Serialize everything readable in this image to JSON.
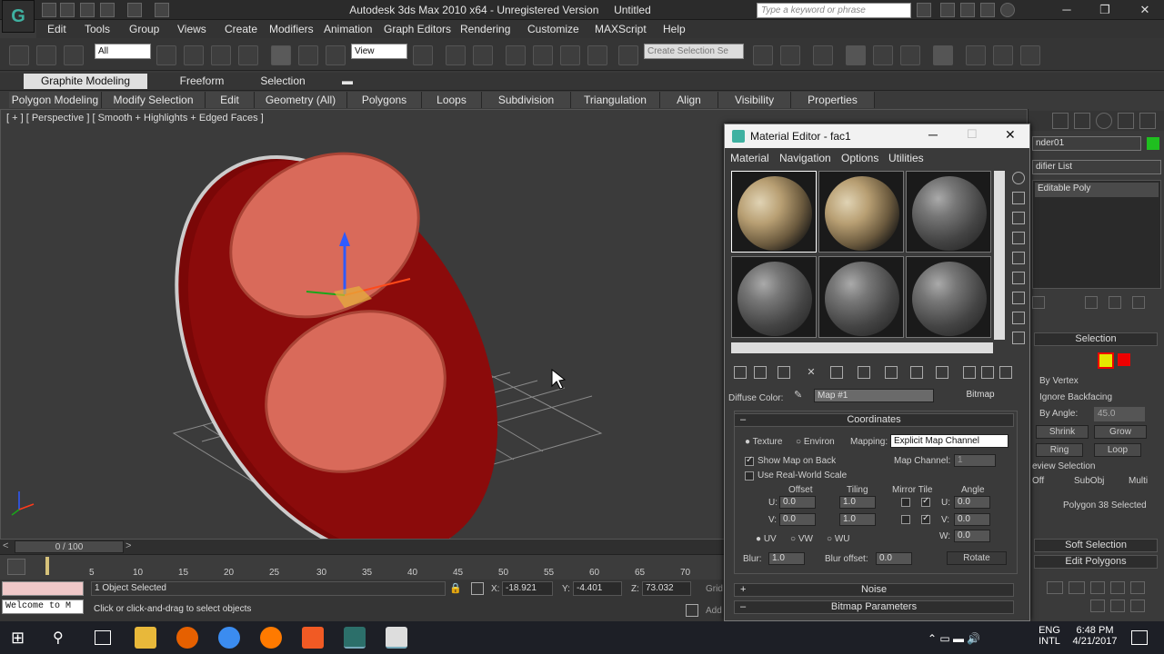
{
  "titlebar": {
    "app_title": "Autodesk 3ds Max  2010 x64  -  Unregistered Version",
    "doc_name": "Untitled",
    "search_placeholder": "Type a keyword or phrase",
    "logo_glyph": "G"
  },
  "menu": [
    "Edit",
    "Tools",
    "Group",
    "Views",
    "Create",
    "Modifiers",
    "Animation",
    "Graph Editors",
    "Rendering",
    "Customize",
    "MAXScript",
    "Help"
  ],
  "toolbar": {
    "filter_value": "All",
    "ref_coord_value": "View",
    "selection_set_placeholder": "Create Selection Se"
  },
  "ribbon": {
    "tabs": [
      "Graphite Modeling Tools",
      "Freeform",
      "Selection"
    ],
    "panels": [
      "Polygon Modeling",
      "Modify Selection",
      "Edit",
      "Geometry (All)",
      "Polygons",
      "Loops",
      "Subdivision",
      "Triangulation",
      "Align",
      "Visibility",
      "Properties"
    ]
  },
  "viewport": {
    "label": "[ + ] [ Perspective ] [ Smooth + Highlights + Edged Faces ]"
  },
  "timeline": {
    "frame_display": "0 / 100",
    "ticks": [
      "5",
      "10",
      "15",
      "20",
      "25",
      "30",
      "35",
      "40",
      "45",
      "50",
      "55",
      "60",
      "65",
      "70"
    ]
  },
  "status": {
    "maxscript_prompt": "Welcome to M",
    "selected": "1 Object Selected",
    "hint": "Click or click-and-drag to select objects",
    "x_label": "X:",
    "x": "-18.921",
    "y_label": "Y:",
    "y": "-4.401",
    "z_label": "Z:",
    "z": "73.032",
    "grid_label": "Grid",
    "add_label": "Add"
  },
  "taskbar": {
    "lang": "ENG",
    "layout": "INTL",
    "time": "6:48 PM",
    "date": "4/21/2017"
  },
  "command_panel": {
    "object_name": "nder01",
    "modifier_list": "difier List",
    "stack_item": "Editable Poly",
    "selection_title": "Selection",
    "by_vertex": "By Vertex",
    "ignore_backfacing": "Ignore Backfacing",
    "by_angle": "By Angle:",
    "by_angle_value": "45.0",
    "shrink": "Shrink",
    "grow": "Grow",
    "ring": "Ring",
    "loop": "Loop",
    "preview_selection": "eview Selection",
    "off": "Off",
    "subobj": "SubObj",
    "multi": "Multi",
    "poly_selected": "Polygon 38 Selected",
    "soft_selection": "Soft Selection",
    "edit_polygons": "Edit Polygons"
  },
  "material_editor": {
    "title": "Material Editor - fac1",
    "menu": [
      "Material",
      "Navigation",
      "Options",
      "Utilities"
    ],
    "diffuse_label": "Diffuse Color:",
    "map_name": "Map #1",
    "map_type": "Bitmap",
    "coordinates_title": "Coordinates",
    "texture": "Texture",
    "environ": "Environ",
    "mapping_label": "Mapping:",
    "mapping_value": "Explicit Map Channel",
    "show_map_on_back": "Show Map on Back",
    "map_channel_label": "Map Channel:",
    "map_channel_value": "1",
    "use_real_world": "Use Real-World Scale",
    "offset": "Offset",
    "tiling": "Tiling",
    "mirror_tile": "Mirror Tile",
    "angle": "Angle",
    "u_label": "U:",
    "v_label": "V:",
    "w_label": "W:",
    "u_offset": "0.0",
    "v_offset": "0.0",
    "u_tiling": "1.0",
    "v_tiling": "1.0",
    "u_angle": "0.0",
    "v_angle": "0.0",
    "w_angle": "0.0",
    "uv": "UV",
    "vw": "VW",
    "wu": "WU",
    "blur_label": "Blur:",
    "blur_value": "1.0",
    "blur_offset_label": "Blur offset:",
    "blur_offset_value": "0.0",
    "rotate": "Rotate",
    "noise_title": "Noise",
    "bitmap_params_title": "Bitmap Parameters",
    "plus_sign": "+",
    "minus_sign": "–"
  },
  "colors": {
    "coin_red": "#8b0b0b",
    "coin_face": "#d96a5a",
    "accent_teal": "#3fb1a1"
  }
}
